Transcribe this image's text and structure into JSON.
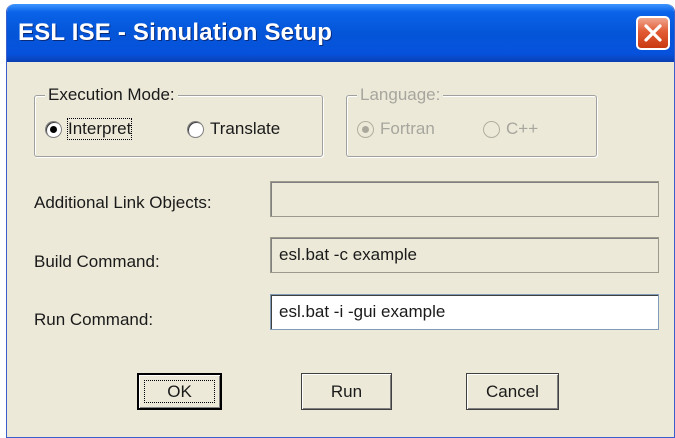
{
  "window": {
    "title": "ESL ISE - Simulation Setup",
    "close_icon": "close-icon"
  },
  "execution_mode": {
    "legend": "Execution Mode:",
    "options": [
      {
        "label": "Interpret",
        "checked": true
      },
      {
        "label": "Translate",
        "checked": false
      }
    ]
  },
  "language": {
    "legend": "Language:",
    "disabled": true,
    "options": [
      {
        "label": "Fortran",
        "checked": true
      },
      {
        "label": "C++",
        "checked": false
      }
    ]
  },
  "fields": {
    "additional_link_objects": {
      "label": "Additional Link Objects:",
      "value": ""
    },
    "build_command": {
      "label": "Build Command:",
      "value": "esl.bat -c example"
    },
    "run_command": {
      "label": "Run Command:",
      "value": "esl.bat -i -gui example"
    }
  },
  "buttons": {
    "ok": "OK",
    "run": "Run",
    "cancel": "Cancel"
  },
  "colors": {
    "titlebar": "#0455d8",
    "dialog_bg": "#ece9d8",
    "close_button": "#e25b34",
    "disabled_text": "#a7a69e"
  }
}
